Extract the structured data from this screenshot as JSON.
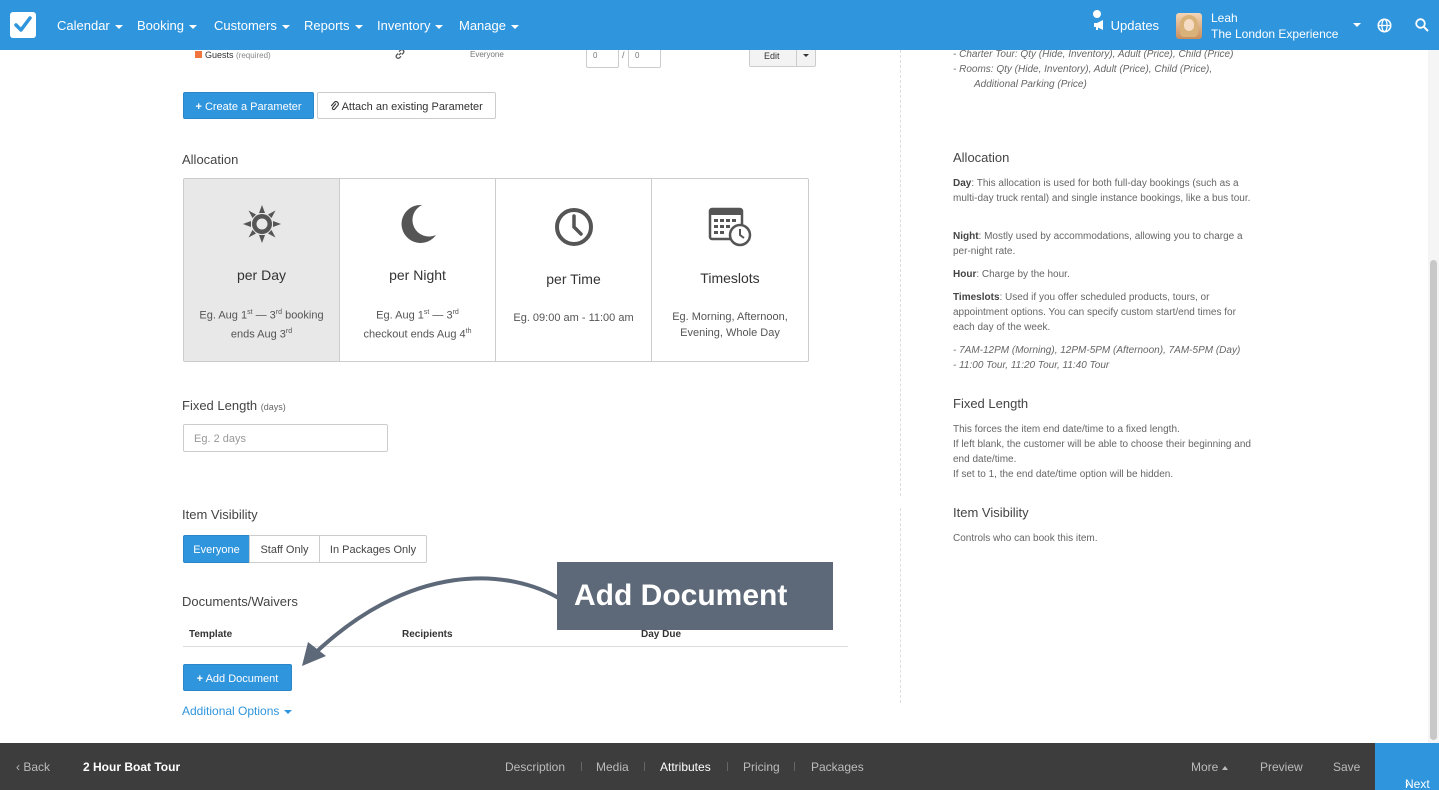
{
  "nav": {
    "items": [
      "Calendar",
      "Booking",
      "Customers",
      "Reports",
      "Inventory",
      "Manage"
    ],
    "updates": "Updates",
    "user_name": "Leah",
    "user_org": "The London Experience"
  },
  "parameters": {
    "guests_label": "Guests",
    "guests_required": "(required)",
    "visibility": "Everyone",
    "min": "0",
    "max": "0",
    "edit": "Edit",
    "create_param": "Create a Parameter",
    "attach_param": "Attach an existing Parameter"
  },
  "allocation": {
    "title": "Allocation",
    "cards": [
      {
        "title": "per Day",
        "line1_pre": "Eg. Aug 1",
        "line1_sup1": "st",
        "line1_mid": " — 3",
        "line1_sup2": "rd",
        "line1_post": " booking",
        "line2_pre": "ends Aug 3",
        "line2_sup": "rd"
      },
      {
        "title": "per Night",
        "line1_pre": "Eg. Aug 1",
        "line1_sup1": "st",
        "line1_mid": " — 3",
        "line1_sup2": "rd",
        "line1_post": "",
        "line2_pre": "checkout ends Aug 4",
        "line2_sup": "th"
      },
      {
        "title": "per Time",
        "desc": "Eg. 09:00 am - 11:00 am"
      },
      {
        "title": "Timeslots",
        "line1": "Eg. Morning, Afternoon,",
        "line2": "Evening, Whole Day"
      }
    ],
    "selected": "per Day"
  },
  "fixed_length": {
    "title": "Fixed Length",
    "unit": "(days)",
    "placeholder": "Eg. 2 days"
  },
  "visibility": {
    "title": "Item Visibility",
    "options": [
      "Everyone",
      "Staff Only",
      "In Packages Only"
    ],
    "selected": "Everyone"
  },
  "documents": {
    "title": "Documents/Waivers",
    "columns": [
      "Template",
      "Recipients",
      "Day Due"
    ],
    "add_button": "Add Document",
    "additional_options": "Additional Options"
  },
  "callout": "Add Document",
  "help": {
    "param_examples": [
      "- Charter Tour: Qty (Hide, Inventory), Adult (Price), Child (Price)",
      "- Rooms: Qty (Hide, Inventory), Adult (Price), Child (Price),",
      "Additional Parking (Price)"
    ],
    "allocation_title": "Allocation",
    "day_term": "Day",
    "day_text": ": This allocation is used for both full-day bookings (such as a multi-day truck rental) and single instance bookings, like a bus tour.",
    "night_term": "Night",
    "night_text": ": Mostly used by accommodations, allowing you to charge a per-night rate.",
    "hour_term": "Hour",
    "hour_text": ": Charge by the hour.",
    "timeslots_term": "Timeslots",
    "timeslots_text": ": Used if you offer scheduled products, tours, or appointment options. You can specify custom start/end times for each day of the week.",
    "timeslot_examples": [
      "- 7AM-12PM (Morning), 12PM-5PM (Afternoon), 7AM-5PM (Day)",
      "- 11:00 Tour, 11:20 Tour, 11:40 Tour"
    ],
    "fixed_title": "Fixed Length",
    "fixed_lines": [
      "This forces the item end date/time to a fixed length.",
      "If left blank, the customer will be able to choose their beginning and end date/time.",
      "If set to 1, the end date/time option will be hidden."
    ],
    "visibility_title": "Item Visibility",
    "visibility_text": "Controls who can book this item."
  },
  "bottom": {
    "back": "Back",
    "item_name": "2 Hour Boat Tour",
    "tabs": [
      "Description",
      "Media",
      "Attributes",
      "Pricing",
      "Packages"
    ],
    "current_tab": "Attributes",
    "more": "More",
    "preview": "Preview",
    "save": "Save",
    "next": "Next"
  },
  "colors": {
    "accent": "#2f95dd",
    "bottom_bar": "#3d3d3d",
    "callout": "#5d6878",
    "guests_marker": "#f0753f"
  }
}
